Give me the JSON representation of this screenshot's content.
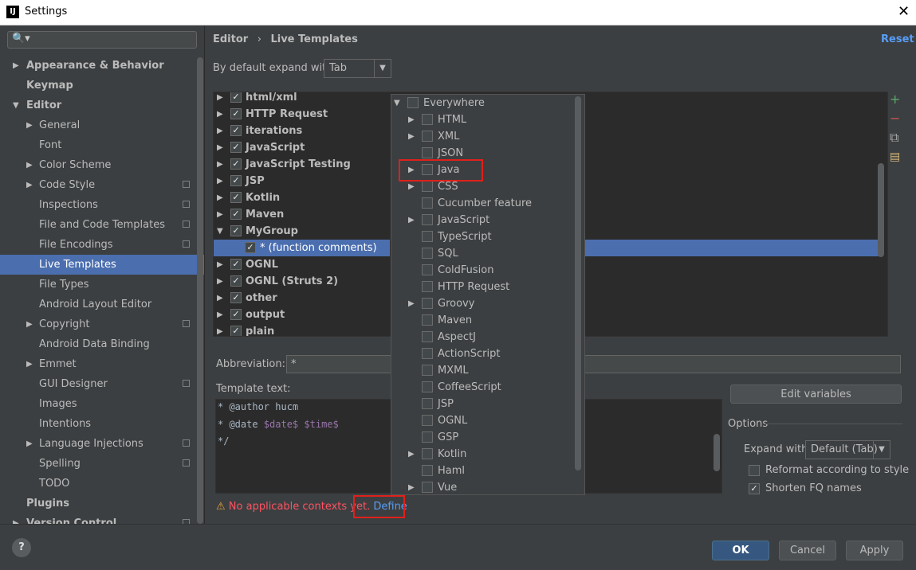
{
  "window": {
    "title": "Settings",
    "app_icon": "IJ",
    "close": "✕"
  },
  "search": {
    "placeholder": "",
    "glyph": "🔍▾"
  },
  "sidebar": {
    "items": [
      {
        "label": "Appearance & Behavior",
        "level": 0,
        "arrow": "right",
        "bold": true
      },
      {
        "label": "Keymap",
        "level": 0,
        "bold": true
      },
      {
        "label": "Editor",
        "level": 0,
        "arrow": "down",
        "bold": true
      },
      {
        "label": "General",
        "level": 1,
        "arrow": "right"
      },
      {
        "label": "Font",
        "level": 1
      },
      {
        "label": "Color Scheme",
        "level": 1,
        "arrow": "right"
      },
      {
        "label": "Code Style",
        "level": 1,
        "arrow": "right",
        "copy": true
      },
      {
        "label": "Inspections",
        "level": 1,
        "copy": true
      },
      {
        "label": "File and Code Templates",
        "level": 1,
        "copy": true
      },
      {
        "label": "File Encodings",
        "level": 1,
        "copy": true
      },
      {
        "label": "Live Templates",
        "level": 1,
        "selected": true
      },
      {
        "label": "File Types",
        "level": 1
      },
      {
        "label": "Android Layout Editor",
        "level": 1
      },
      {
        "label": "Copyright",
        "level": 1,
        "arrow": "right",
        "copy": true
      },
      {
        "label": "Android Data Binding",
        "level": 1
      },
      {
        "label": "Emmet",
        "level": 1,
        "arrow": "right"
      },
      {
        "label": "GUI Designer",
        "level": 1,
        "copy": true
      },
      {
        "label": "Images",
        "level": 1
      },
      {
        "label": "Intentions",
        "level": 1
      },
      {
        "label": "Language Injections",
        "level": 1,
        "arrow": "right",
        "copy": true
      },
      {
        "label": "Spelling",
        "level": 1,
        "copy": true
      },
      {
        "label": "TODO",
        "level": 1
      },
      {
        "label": "Plugins",
        "level": 0,
        "bold": true
      },
      {
        "label": "Version Control",
        "level": 0,
        "arrow": "right",
        "bold": true,
        "copy": true
      }
    ]
  },
  "header": {
    "crumb_parent": "Editor",
    "crumb_sep": "›",
    "crumb_current": "Live Templates",
    "reset": "Reset"
  },
  "expand_with": {
    "label": "By default expand with",
    "value": "Tab"
  },
  "templates": [
    {
      "label": "html/xml",
      "checked": true,
      "arrow": "right"
    },
    {
      "label": "HTTP Request",
      "checked": true,
      "arrow": "right"
    },
    {
      "label": "iterations",
      "checked": true,
      "arrow": "right"
    },
    {
      "label": "JavaScript",
      "checked": true,
      "arrow": "right"
    },
    {
      "label": "JavaScript Testing",
      "checked": true,
      "arrow": "right"
    },
    {
      "label": "JSP",
      "checked": true,
      "arrow": "right"
    },
    {
      "label": "Kotlin",
      "checked": true,
      "arrow": "right"
    },
    {
      "label": "Maven",
      "checked": true,
      "arrow": "right"
    },
    {
      "label": "MyGroup",
      "checked": true,
      "arrow": "down"
    },
    {
      "label": "* (function comments)",
      "checked": true,
      "child": true,
      "selected": true
    },
    {
      "label": "OGNL",
      "checked": true,
      "arrow": "right"
    },
    {
      "label": "OGNL (Struts 2)",
      "checked": true,
      "arrow": "right"
    },
    {
      "label": "other",
      "checked": true,
      "arrow": "right"
    },
    {
      "label": "output",
      "checked": true,
      "arrow": "right"
    },
    {
      "label": "plain",
      "checked": true,
      "arrow": "right"
    }
  ],
  "toolbar": {
    "add": "+",
    "remove": "−",
    "copy": "⧉",
    "template": "▤"
  },
  "abbreviation": {
    "label": "Abbreviation:",
    "value": "*"
  },
  "template_text": {
    "label": "Template text:",
    "line1": "* @author hucm",
    "line2_prefix": "* @date ",
    "line2_var1": "$date$",
    "line2_space": " ",
    "line2_var2": "$time$",
    "line3": "*/"
  },
  "edit_variables": "Edit variables",
  "options": {
    "title": "Options",
    "expand_label": "Expand with",
    "expand_value": "Default (Tab)",
    "reformat": {
      "label": "Reformat according to style",
      "checked": false
    },
    "shorten": {
      "label": "Shorten FQ names",
      "checked": true
    }
  },
  "warning": {
    "icon": "⚠",
    "text": "No applicable contexts yet.",
    "link": "Define"
  },
  "contexts": [
    {
      "label": "Everywhere",
      "arrow": "down",
      "level": 0
    },
    {
      "label": "HTML",
      "arrow": "right",
      "level": 1
    },
    {
      "label": "XML",
      "arrow": "right",
      "level": 1
    },
    {
      "label": "JSON",
      "level": 1
    },
    {
      "label": "Java",
      "arrow": "right",
      "level": 1
    },
    {
      "label": "CSS",
      "arrow": "right",
      "level": 1
    },
    {
      "label": "Cucumber feature",
      "level": 1
    },
    {
      "label": "JavaScript",
      "arrow": "right",
      "level": 1
    },
    {
      "label": "TypeScript",
      "level": 1
    },
    {
      "label": "SQL",
      "level": 1
    },
    {
      "label": "ColdFusion",
      "level": 1
    },
    {
      "label": "HTTP Request",
      "level": 1
    },
    {
      "label": "Groovy",
      "arrow": "right",
      "level": 1
    },
    {
      "label": "Maven",
      "level": 1
    },
    {
      "label": "AspectJ",
      "level": 1
    },
    {
      "label": "ActionScript",
      "level": 1
    },
    {
      "label": "MXML",
      "level": 1
    },
    {
      "label": "CoffeeScript",
      "level": 1
    },
    {
      "label": "JSP",
      "level": 1
    },
    {
      "label": "OGNL",
      "level": 1
    },
    {
      "label": "GSP",
      "level": 1
    },
    {
      "label": "Kotlin",
      "arrow": "right",
      "level": 1
    },
    {
      "label": "Haml",
      "level": 1
    },
    {
      "label": "Vue",
      "arrow": "right",
      "level": 1
    }
  ],
  "buttons": {
    "help": "?",
    "ok": "OK",
    "cancel": "Cancel",
    "apply": "Apply"
  },
  "colors": {
    "selection": "#4b6eaf",
    "highlight_box": "#e0201b",
    "link": "#589df6",
    "error": "#ff5261"
  }
}
